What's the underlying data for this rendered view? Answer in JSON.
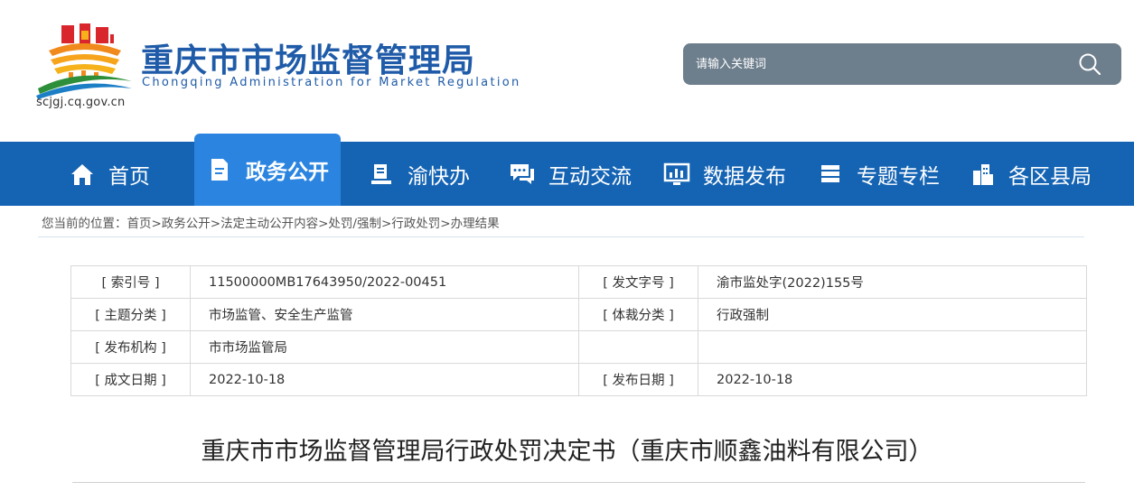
{
  "header": {
    "title_cn": "重庆市市场监督管理局",
    "title_en": "Chongqing  Administration for Market Regulation",
    "site_url": "scjgj.cq.gov.cn",
    "search_placeholder": "请输入关键词"
  },
  "nav": [
    {
      "label": "首页",
      "icon": "home-icon"
    },
    {
      "label": "政务公开",
      "icon": "document-icon"
    },
    {
      "label": "渝快办",
      "icon": "stack-icon"
    },
    {
      "label": "互动交流",
      "icon": "chat-icon"
    },
    {
      "label": "数据发布",
      "icon": "monitor-chart-icon"
    },
    {
      "label": "专题专栏",
      "icon": "server-icon"
    },
    {
      "label": "各区县局",
      "icon": "buildings-icon"
    }
  ],
  "breadcrumb": "您当前的位置：首页>政务公开>法定主动公开内容>处罚/强制>行政处罚>办理结果",
  "info": {
    "row1": {
      "k1": "[ 索引号 ]",
      "v1": "11500000MB17643950/2022-00451",
      "k2": "[ 发文字号 ]",
      "v2": "渝市监处字(2022)155号"
    },
    "row2": {
      "k1": "[ 主题分类 ]",
      "v1": "市场监管、安全生产监管",
      "k2": "[ 体裁分类 ]",
      "v2": "行政强制"
    },
    "row3": {
      "k1": "[ 发布机构 ]",
      "v1": "市市场监管局",
      "k2": "",
      "v2": ""
    },
    "row4": {
      "k1": "[ 成文日期 ]",
      "v1": "2022-10-18",
      "k2": "[ 发布日期 ]",
      "v2": "2022-10-18"
    }
  },
  "doc_title": "重庆市市场监督管理局行政处罚决定书（重庆市顺鑫油料有限公司）",
  "colors": {
    "nav_bg": "#1564b4",
    "nav_active": "#2b85e0",
    "brand": "#1f5ba8",
    "search_bg": "#6d7e8c"
  }
}
